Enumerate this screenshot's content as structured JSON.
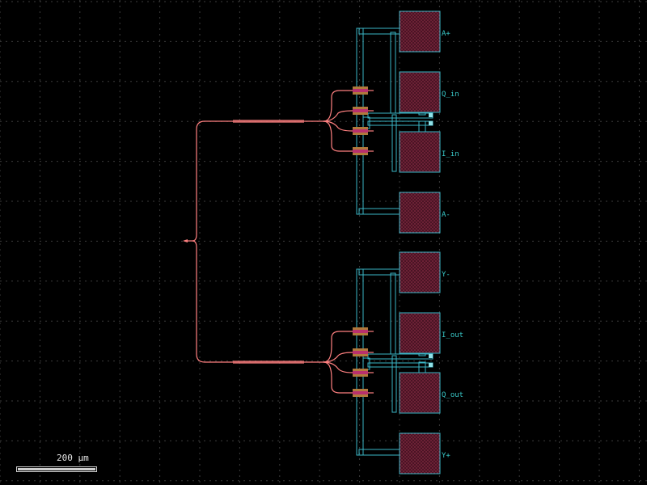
{
  "scale": {
    "label": "200 µm"
  },
  "pads": [
    {
      "name": "pad-a-plus",
      "label": "A+"
    },
    {
      "name": "pad-q-in",
      "label": "Q_in"
    },
    {
      "name": "pad-i-in",
      "label": "I_in"
    },
    {
      "name": "pad-a-minus",
      "label": "A-"
    },
    {
      "name": "pad-y-minus",
      "label": "Y-"
    },
    {
      "name": "pad-i-out",
      "label": "I_out"
    },
    {
      "name": "pad-q-out",
      "label": "Q_out"
    },
    {
      "name": "pad-y-plus",
      "label": "Y+"
    }
  ],
  "colors": {
    "background": "#000000",
    "grid": "#3a3a3a",
    "waveguide": "#ff7f7f",
    "metal": "#3ab6c6",
    "pad_fill": "#5a1a2a",
    "heater": "#b0306a",
    "heater_cap": "#b08040",
    "label": "#38c8c8"
  },
  "icons": [
    "scale-bar-icon"
  ]
}
